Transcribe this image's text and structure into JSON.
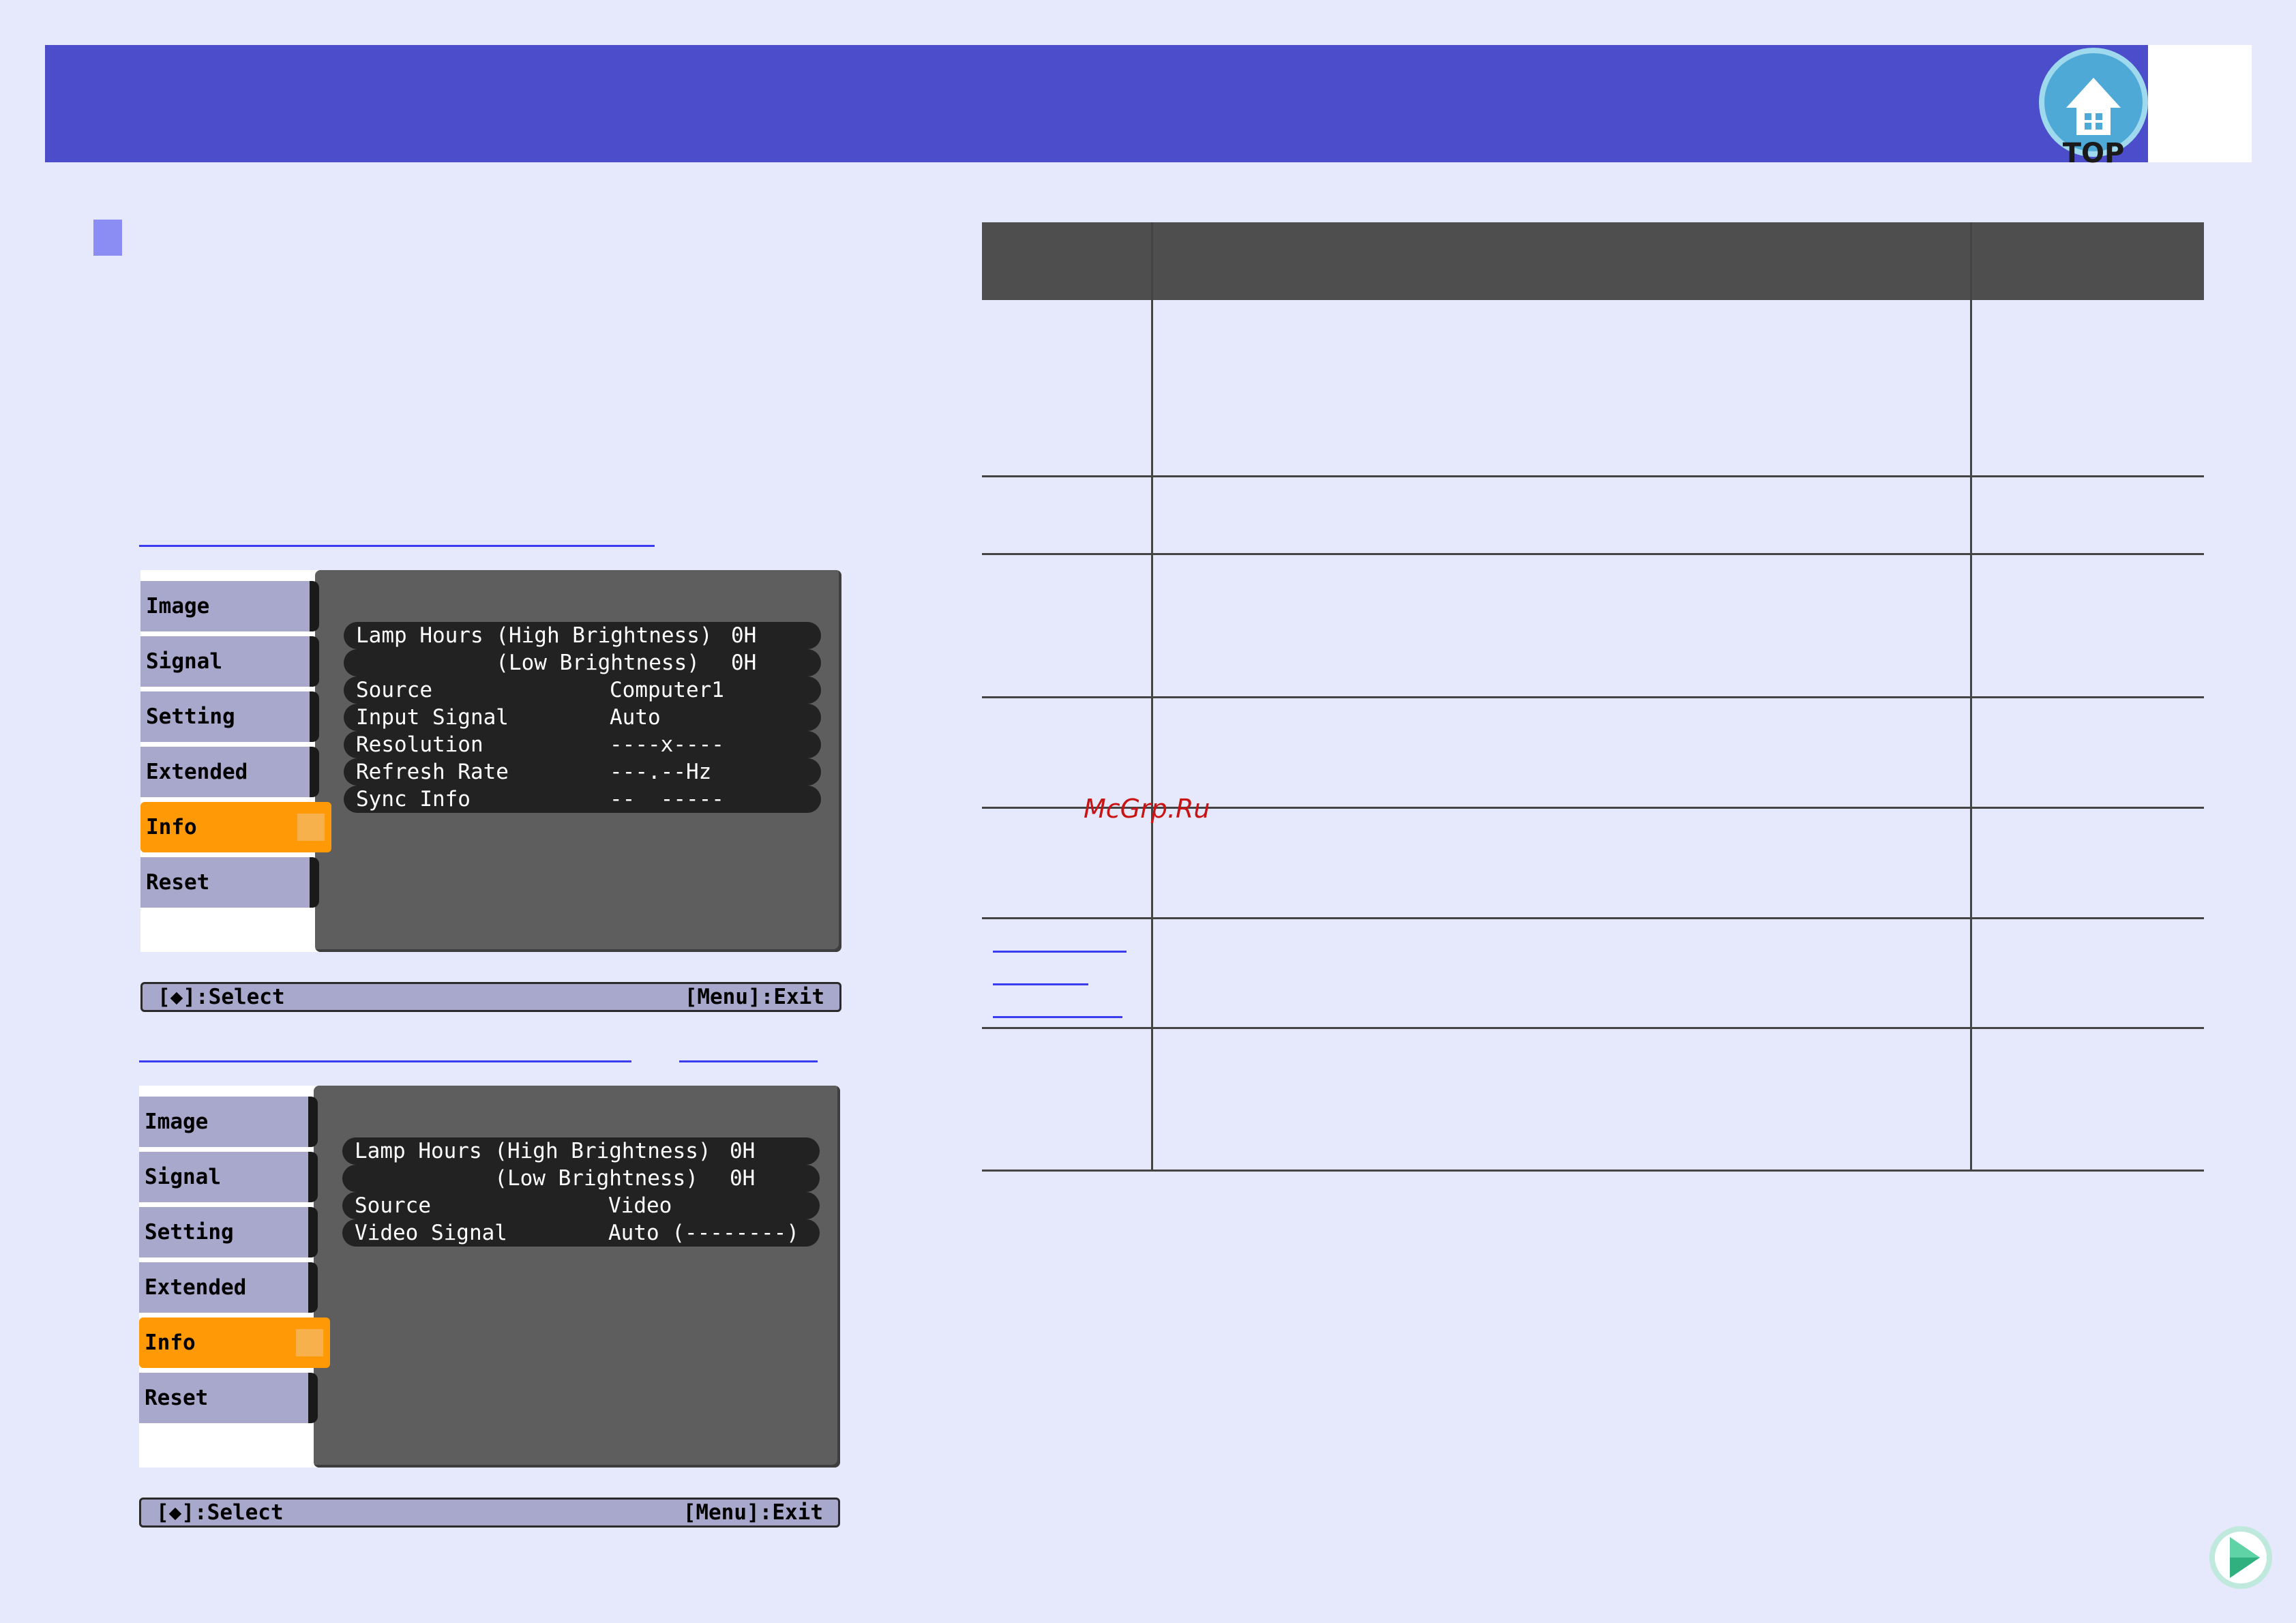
{
  "header": {
    "top_icon_label": "TOP"
  },
  "watermark": "McGrp.Ru",
  "menus": [
    {
      "tabs": [
        "Image",
        "Signal",
        "Setting",
        "Extended",
        "Info",
        "Reset"
      ],
      "active_tab": "Info",
      "rows": [
        {
          "label": "Lamp Hours (High Brightness)",
          "value": "0H"
        },
        {
          "label": "           (Low Brightness)",
          "value": "0H"
        },
        {
          "label": "Source",
          "value": "Computer1"
        },
        {
          "label": "Input Signal",
          "value": "Auto"
        },
        {
          "label": "Resolution",
          "value": "----x----"
        },
        {
          "label": "Refresh Rate",
          "value": "---.--Hz"
        },
        {
          "label": "Sync Info",
          "value": "--  -----"
        }
      ],
      "footer_left": "[◆]:Select",
      "footer_right": "[Menu]:Exit"
    },
    {
      "tabs": [
        "Image",
        "Signal",
        "Setting",
        "Extended",
        "Info",
        "Reset"
      ],
      "active_tab": "Info",
      "rows": [
        {
          "label": "Lamp Hours (High Brightness)",
          "value": "0H"
        },
        {
          "label": "           (Low Brightness)",
          "value": "0H"
        },
        {
          "label": "Source",
          "value": "Video"
        },
        {
          "label": "Video Signal",
          "value": "Auto (--------)"
        }
      ],
      "footer_left": "[◆]:Select",
      "footer_right": "[Menu]:Exit"
    }
  ]
}
